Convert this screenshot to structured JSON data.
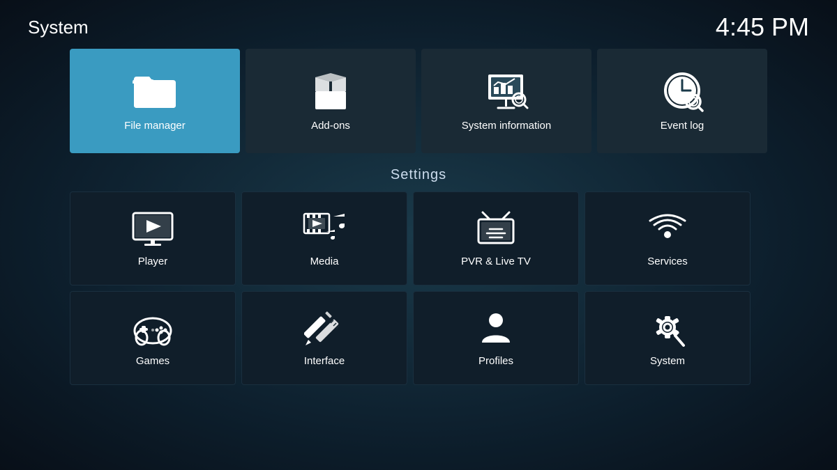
{
  "header": {
    "title": "System",
    "time": "4:45 PM"
  },
  "top_tiles": [
    {
      "id": "file-manager",
      "label": "File manager",
      "active": true
    },
    {
      "id": "add-ons",
      "label": "Add-ons",
      "active": false
    },
    {
      "id": "system-information",
      "label": "System information",
      "active": false
    },
    {
      "id": "event-log",
      "label": "Event log",
      "active": false
    }
  ],
  "settings_label": "Settings",
  "settings_tiles_row1": [
    {
      "id": "player",
      "label": "Player"
    },
    {
      "id": "media",
      "label": "Media"
    },
    {
      "id": "pvr-live-tv",
      "label": "PVR & Live TV"
    },
    {
      "id": "services",
      "label": "Services"
    }
  ],
  "settings_tiles_row2": [
    {
      "id": "games",
      "label": "Games"
    },
    {
      "id": "interface",
      "label": "Interface"
    },
    {
      "id": "profiles",
      "label": "Profiles"
    },
    {
      "id": "system",
      "label": "System"
    }
  ]
}
